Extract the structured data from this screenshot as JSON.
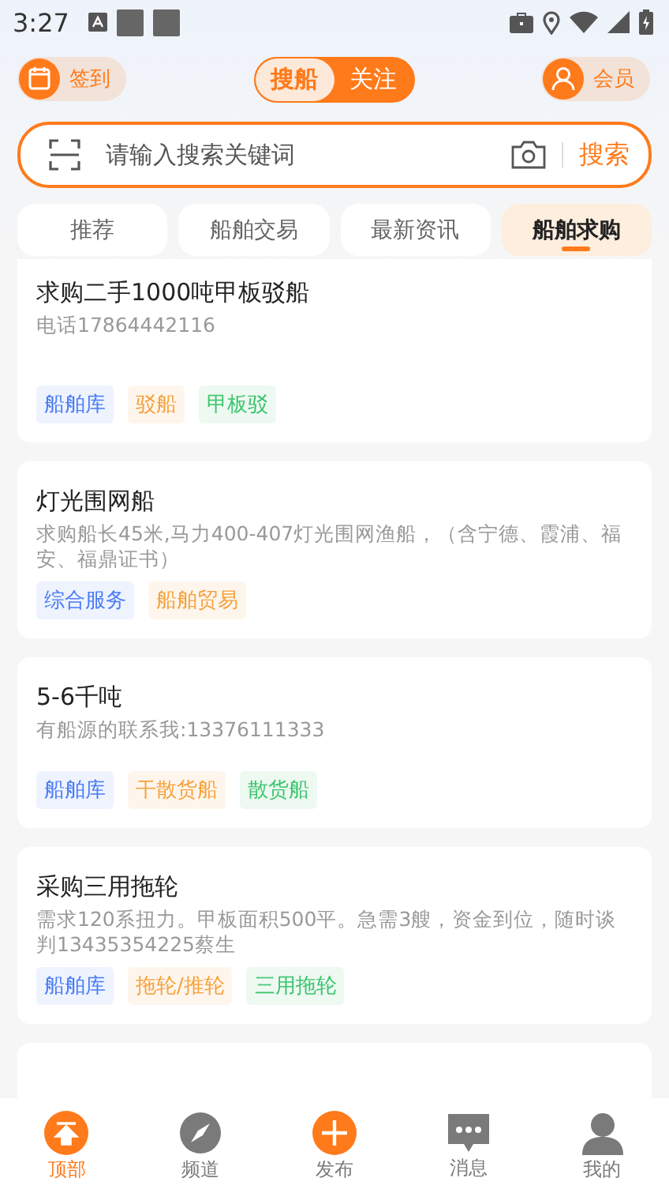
{
  "status_bar": {
    "time": "3:27"
  },
  "header": {
    "checkin": "签到",
    "toggle": [
      {
        "label": "搜船",
        "selected": true
      },
      {
        "label": "关注",
        "selected": false
      }
    ],
    "member": "会员"
  },
  "search": {
    "placeholder": "请输入搜索关键词",
    "button": "搜索"
  },
  "tabs": [
    {
      "label": "推荐",
      "selected": false
    },
    {
      "label": "船舶交易",
      "selected": false
    },
    {
      "label": "最新资讯",
      "selected": false
    },
    {
      "label": "船舶求购",
      "selected": true
    }
  ],
  "posts": [
    {
      "title": "求购二手1000吨甲板驳船",
      "desc": "电话17864442116",
      "tags": [
        {
          "text": "船舶库",
          "color": "#4a7cf6"
        },
        {
          "text": "驳船",
          "color": "#f7a13b"
        },
        {
          "text": "甲板驳",
          "color": "#3cc46e"
        }
      ]
    },
    {
      "title": "灯光围网船",
      "desc": "求购船长45米,马力400-407灯光围网渔船，（含宁德、霞浦、福安、福鼎证书）",
      "tags": [
        {
          "text": "综合服务",
          "color": "#4a7cf6"
        },
        {
          "text": "船舶贸易",
          "color": "#f7a13b"
        }
      ]
    },
    {
      "title": "5-6千吨",
      "desc": "有船源的联系我:13376111333",
      "tags": [
        {
          "text": "船舶库",
          "color": "#4a7cf6"
        },
        {
          "text": "干散货船",
          "color": "#f7a13b"
        },
        {
          "text": "散货船",
          "color": "#3cc46e"
        }
      ]
    },
    {
      "title": "采购三用拖轮",
      "desc": "需求120系扭力。甲板面积500平。急需3艘，资金到位，随时谈判13435354225蔡生",
      "tags": [
        {
          "text": "船舶库",
          "color": "#4a7cf6"
        },
        {
          "text": "拖轮/推轮",
          "color": "#f7a13b"
        },
        {
          "text": "三用拖轮",
          "color": "#3cc46e"
        }
      ]
    }
  ],
  "bottom_nav": [
    {
      "label": "顶部",
      "kind": "top",
      "selected": true
    },
    {
      "label": "频道",
      "kind": "channel",
      "selected": false
    },
    {
      "label": "发布",
      "kind": "publish",
      "selected": false
    },
    {
      "label": "消息",
      "kind": "message",
      "selected": false
    },
    {
      "label": "我的",
      "kind": "profile",
      "selected": false
    }
  ]
}
